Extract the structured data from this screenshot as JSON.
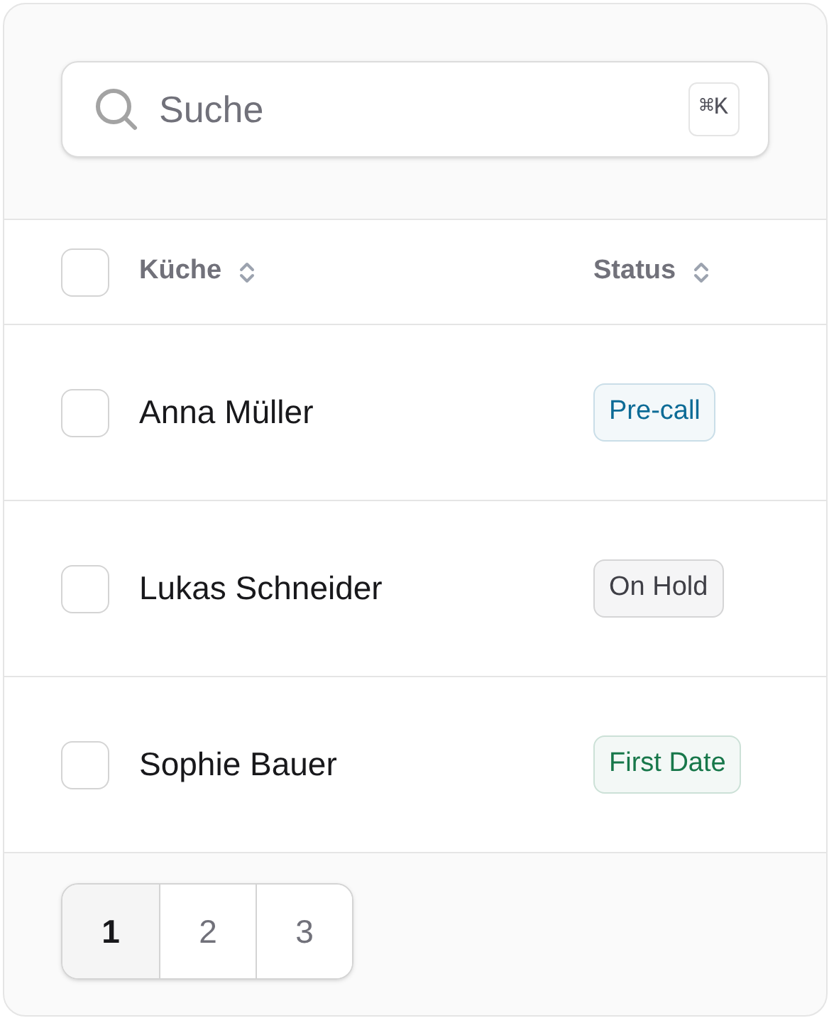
{
  "search": {
    "placeholder": "Suche",
    "shortcut": "⌘K"
  },
  "table": {
    "select_all": {
      "checked": false
    },
    "columns": [
      {
        "label": "Küche"
      },
      {
        "label": "Status"
      }
    ],
    "rows": [
      {
        "checked": false,
        "name": "Anna Müller",
        "status": "Pre-call",
        "color": "#0c6b96"
      },
      {
        "checked": false,
        "name": "Lukas Schneider",
        "status": "On Hold",
        "color": "#3f3f46"
      },
      {
        "checked": false,
        "name": "Sophie Bauer",
        "status": "First Date",
        "color": "#17774a"
      }
    ]
  },
  "pagination": [
    {
      "label": "1",
      "selected": true
    },
    {
      "label": "2",
      "selected": false
    },
    {
      "label": "3",
      "selected": false
    }
  ]
}
